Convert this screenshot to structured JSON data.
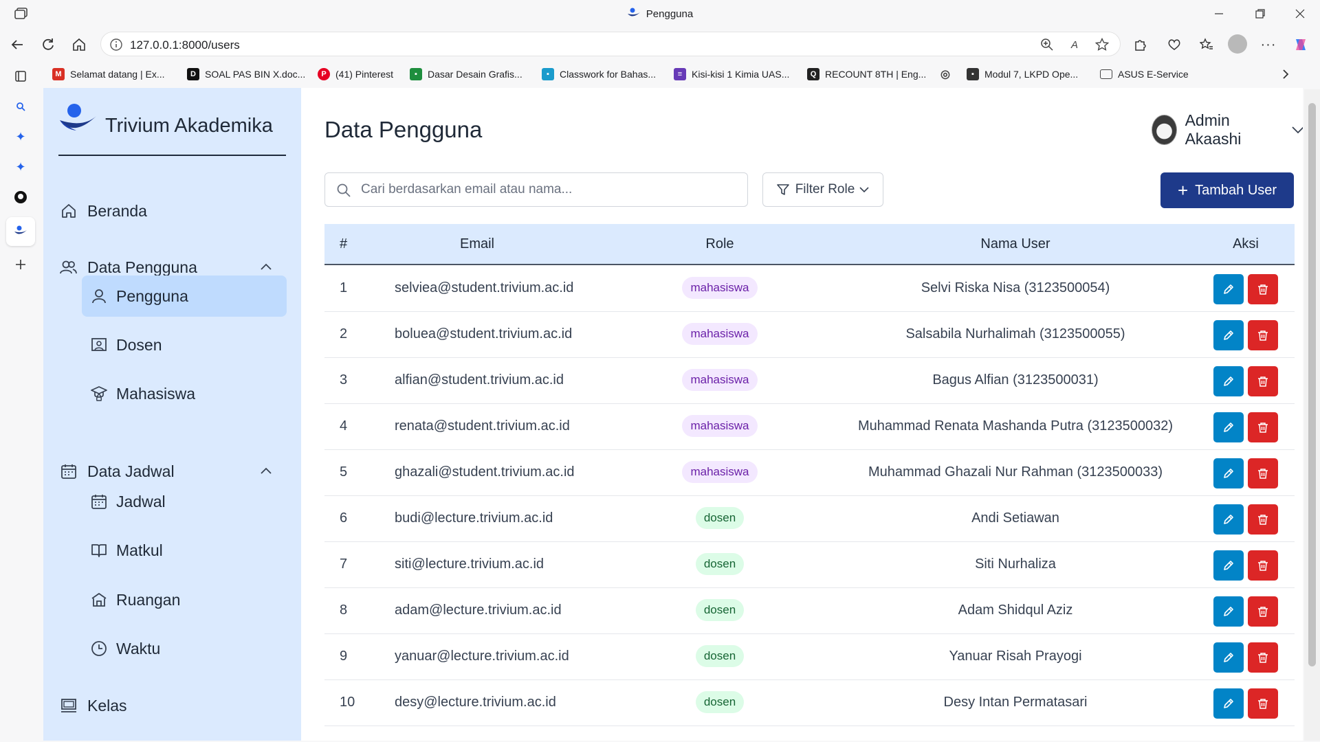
{
  "browser": {
    "tab_title": "Pengguna",
    "url": "127.0.0.1:8000/users",
    "bookmarks": [
      {
        "label": "Selamat datang | Ex...",
        "color": "#d93025",
        "icon": "mail-icon"
      },
      {
        "label": "SOAL PAS BIN X.doc...",
        "color": "#111111",
        "icon": "doc-icon"
      },
      {
        "label": "(41) Pinterest",
        "color": "#e60023",
        "icon": "pinterest-icon"
      },
      {
        "label": "Dasar Desain Grafis...",
        "color": "#1e8e3e",
        "icon": "classroom-icon"
      },
      {
        "label": "Classwork for Bahas...",
        "color": "#1a9bcc",
        "icon": "classroom-icon"
      },
      {
        "label": "Kisi-kisi 1 Kimia UAS...",
        "color": "#673ab7",
        "icon": "forms-icon"
      },
      {
        "label": "RECOUNT 8TH | Eng...",
        "color": "#222222",
        "icon": "quizizz-icon"
      },
      {
        "label": "",
        "color": "#444444",
        "icon": "globe-icon"
      },
      {
        "label": "Modul 7, LKPD Ope...",
        "color": "#333333",
        "icon": "doc-icon"
      },
      {
        "label": "ASUS E-Service",
        "color": "#444444",
        "icon": "folder-icon"
      }
    ]
  },
  "app": {
    "brand": "Trivium Akademika",
    "colors": {
      "sidebar_bg": "#dbeafe",
      "active_bg": "#bfdbfe",
      "primary": "#1e3a8a",
      "edit": "#0284c7",
      "delete": "#dc2626"
    },
    "nav": {
      "beranda": "Beranda",
      "data_pengguna": "Data Pengguna",
      "pengguna": "Pengguna",
      "dosen": "Dosen",
      "mahasiswa": "Mahasiswa",
      "data_jadwal": "Data Jadwal",
      "jadwal": "Jadwal",
      "matkul": "Matkul",
      "ruangan": "Ruangan",
      "waktu": "Waktu",
      "kelas": "Kelas"
    },
    "page_title": "Data Pengguna",
    "user": {
      "name": "Admin Akaashi"
    },
    "search": {
      "placeholder": "Cari berdasarkan email atau nama..."
    },
    "filter_label": "Filter Role",
    "add_label": "Tambah User",
    "table": {
      "headers": {
        "num": "#",
        "email": "Email",
        "role": "Role",
        "name": "Nama User",
        "action": "Aksi"
      },
      "rows": [
        {
          "num": "1",
          "email": "selviea@student.trivium.ac.id",
          "role": "mahasiswa",
          "name": "Selvi Riska Nisa (3123500054)"
        },
        {
          "num": "2",
          "email": "boluea@student.trivium.ac.id",
          "role": "mahasiswa",
          "name": "Salsabila Nurhalimah (3123500055)"
        },
        {
          "num": "3",
          "email": "alfian@student.trivium.ac.id",
          "role": "mahasiswa",
          "name": "Bagus Alfian (3123500031)"
        },
        {
          "num": "4",
          "email": "renata@student.trivium.ac.id",
          "role": "mahasiswa",
          "name": "Muhammad Renata Mashanda Putra (3123500032)"
        },
        {
          "num": "5",
          "email": "ghazali@student.trivium.ac.id",
          "role": "mahasiswa",
          "name": "Muhammad Ghazali Nur Rahman (3123500033)"
        },
        {
          "num": "6",
          "email": "budi@lecture.trivium.ac.id",
          "role": "dosen",
          "name": "Andi Setiawan"
        },
        {
          "num": "7",
          "email": "siti@lecture.trivium.ac.id",
          "role": "dosen",
          "name": "Siti Nurhaliza"
        },
        {
          "num": "8",
          "email": "adam@lecture.trivium.ac.id",
          "role": "dosen",
          "name": "Adam Shidqul Aziz"
        },
        {
          "num": "9",
          "email": "yanuar@lecture.trivium.ac.id",
          "role": "dosen",
          "name": "Yanuar Risah Prayogi"
        },
        {
          "num": "10",
          "email": "desy@lecture.trivium.ac.id",
          "role": "dosen",
          "name": "Desy Intan Permatasari"
        }
      ]
    }
  }
}
